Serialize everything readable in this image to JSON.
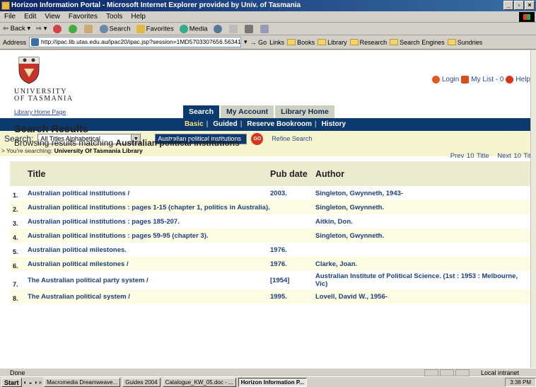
{
  "window": {
    "title": "Horizon Information Portal - Microsoft Internet Explorer provided by Univ. of Tasmania"
  },
  "menu": [
    "File",
    "Edit",
    "View",
    "Favorites",
    "Tools",
    "Help"
  ],
  "toolbar": {
    "back": "Back",
    "search": "Search",
    "favorites": "Favorites",
    "media": "Media"
  },
  "address": {
    "label": "Address",
    "url": "http://ipac.lib.utas.edu.au/ipac20/ipac.jsp?session=1MD5703307656.563418profile=cent&pag",
    "go": "Go",
    "links_label": "Links",
    "links": [
      "Books",
      "Library",
      "Research",
      "Search Engines",
      "Sundries"
    ]
  },
  "header": {
    "university_line1": "UNIVERSITY",
    "university_line2": "OF TASMANIA",
    "library_home_link": "Library Home Page",
    "login": "Login",
    "my_list": "My List - 0",
    "help": "Help"
  },
  "tabs": [
    "Search",
    "My Account",
    "Library Home"
  ],
  "subnav": [
    "Basic",
    "Guided",
    "Reserve Bookroom",
    "History"
  ],
  "search": {
    "label": "Search:",
    "index_selected": "All Titles Alphabetical",
    "query": "Australian political institutions",
    "go_label": "GO",
    "refine": "Refine Search",
    "scope_prefix": "> You're searching:",
    "scope_value": "University Of Tasmania Library"
  },
  "results": {
    "heading": "Search Results",
    "browsing_prefix": "Browsing results matching",
    "browsing_term": "Australian political institutions",
    "prev": "Prev 10 Title",
    "next": "Next 10 Title",
    "columns": {
      "title": "Title",
      "pub_date": "Pub date",
      "author": "Author"
    },
    "rows": [
      {
        "num": "1.",
        "title": "Australian political institutions /",
        "date": "2003.",
        "author": "Singleton, Gwynneth, 1943-"
      },
      {
        "num": "2.",
        "title": "Australian political institutions : pages 1-15 (chapter 1, politics in Australia).",
        "date": "",
        "author": "Singleton, Gwynneth."
      },
      {
        "num": "3.",
        "title": "Australian political institutions : pages 185-207.",
        "date": "",
        "author": "Aitkin, Don."
      },
      {
        "num": "4.",
        "title": "Australian political institutions : pages 59-95 (chapter 3).",
        "date": "",
        "author": "Singleton, Gwynneth."
      },
      {
        "num": "5.",
        "title": "Australian political milestones.",
        "date": "1976.",
        "author": ""
      },
      {
        "num": "6.",
        "title": "Australian political milestones /",
        "date": "1976.",
        "author": "Clarke, Joan."
      },
      {
        "num": "7.",
        "title": "The Australian political party system /",
        "date": "[1954]",
        "author": "Australian Institute of Political Science. (1st : 1953 : Melbourne, Vic)"
      },
      {
        "num": "8.",
        "title": "The Australian political system /",
        "date": "1995.",
        "author": "Lovell, David W., 1956-"
      }
    ]
  },
  "status": {
    "text": "Done",
    "zone": "Local intranet"
  },
  "taskbar": {
    "start": "Start",
    "tasks": [
      "Macromedia Dreamweave...",
      "Guides 2004",
      "Catalogue_KW_05.doc - ...",
      "Horizon Information P..."
    ],
    "clock": "3:38 PM"
  },
  "colors": {
    "nav_blue": "#0d3a6e",
    "link_blue": "#1d3f7a",
    "search_bg": "#f6f4cf",
    "header_row": "#ecebd0"
  }
}
